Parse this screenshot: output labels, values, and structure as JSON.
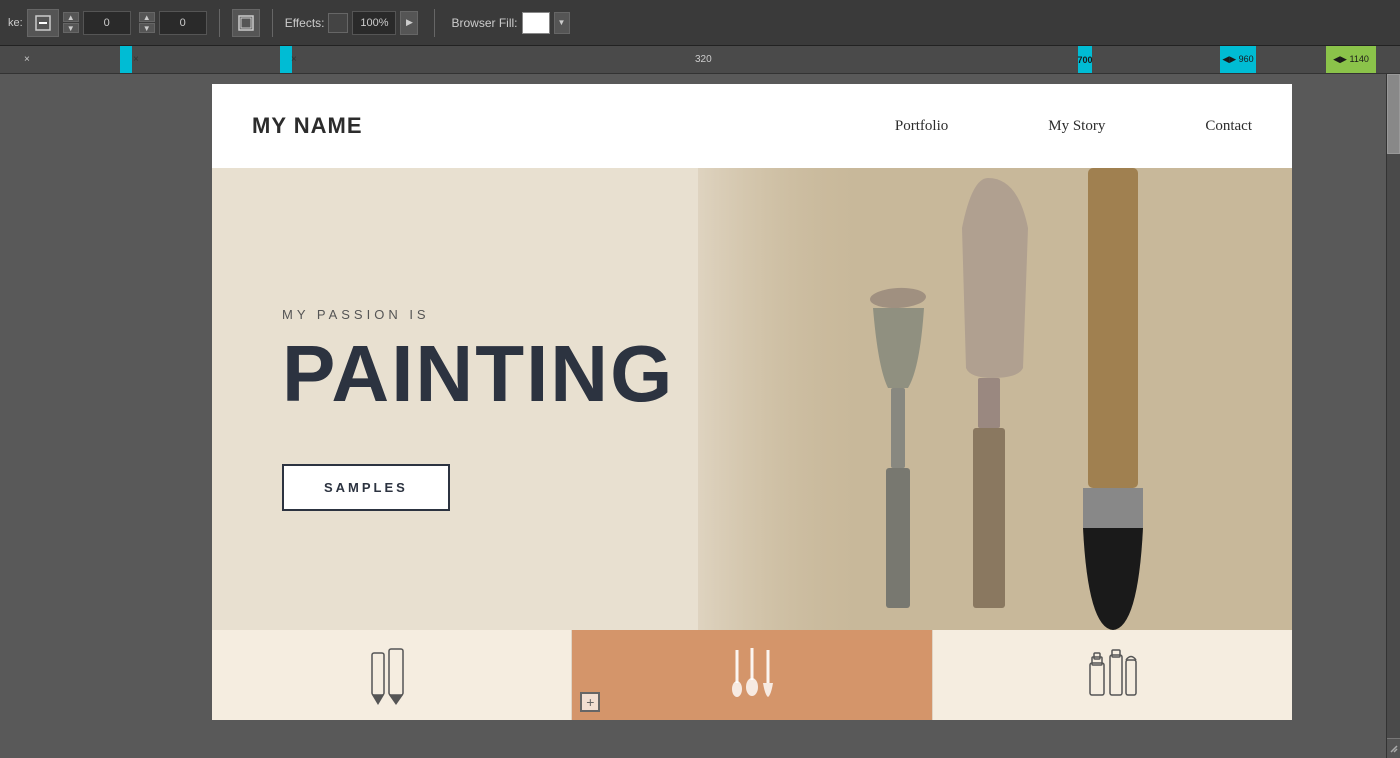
{
  "toolbar": {
    "stroke_icon": "✏",
    "x_value": "0",
    "y_value": "0",
    "effects_label": "Effects:",
    "zoom_value": "100%",
    "browser_fill_label": "Browser Fill:"
  },
  "ruler": {
    "markers": [
      {
        "label": "×",
        "position": 24,
        "type": "close"
      },
      {
        "label": "",
        "position": 120,
        "type": "cyan"
      },
      {
        "label": "×",
        "position": 130,
        "type": "close"
      },
      {
        "label": "",
        "position": 280,
        "type": "cyan"
      },
      {
        "label": "×",
        "position": 288,
        "type": "close"
      },
      {
        "label": "320",
        "position": 700,
        "type": "label"
      },
      {
        "label": "700",
        "position": 1078,
        "type": "label-cyan"
      },
      {
        "label": "960",
        "position": 1230,
        "type": "label-cyan"
      },
      {
        "label": "1140",
        "position": 1350,
        "type": "label-cyan"
      }
    ]
  },
  "site": {
    "logo": "MY NAME",
    "nav": {
      "items": [
        {
          "label": "Portfolio"
        },
        {
          "label": "My Story"
        },
        {
          "label": "Contact"
        }
      ]
    },
    "hero": {
      "subtitle": "MY PASSION IS",
      "title": "PAINTING",
      "button_label": "SAMPLES"
    },
    "bottom_sections": [
      {
        "icon": "pencil",
        "highlighted": false
      },
      {
        "icon": "brush-set",
        "highlighted": true,
        "has_add": true
      },
      {
        "icon": "bottles",
        "highlighted": false
      }
    ]
  }
}
